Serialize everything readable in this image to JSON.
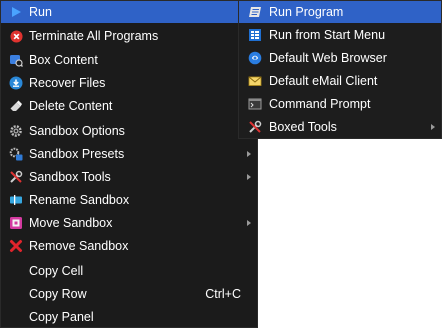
{
  "main_menu": {
    "items": [
      {
        "label": "Run",
        "icon": "play-icon",
        "submenu": true,
        "highlighted": true
      },
      {
        "label": "Terminate All Programs",
        "icon": "terminate-icon"
      },
      {
        "label": "Box Content",
        "icon": "box-content-icon"
      },
      {
        "label": "Recover Files",
        "icon": "recover-icon"
      },
      {
        "label": "Delete Content",
        "icon": "eraser-icon"
      },
      {
        "label": "Sandbox Options",
        "icon": "gear-icon"
      },
      {
        "label": "Sandbox Presets",
        "icon": "presets-icon",
        "submenu": true
      },
      {
        "label": "Sandbox Tools",
        "icon": "tools-icon",
        "submenu": true
      },
      {
        "label": "Rename Sandbox",
        "icon": "rename-icon"
      },
      {
        "label": "Move Sandbox",
        "icon": "move-icon",
        "submenu": true
      },
      {
        "label": "Remove Sandbox",
        "icon": "remove-icon"
      },
      {
        "label": "Copy Cell"
      },
      {
        "label": "Copy Row",
        "shortcut": "Ctrl+C"
      },
      {
        "label": "Copy Panel"
      }
    ]
  },
  "run_submenu": {
    "items": [
      {
        "label": "Run Program",
        "icon": "run-program-icon",
        "highlighted": true
      },
      {
        "label": "Run from Start Menu",
        "icon": "start-menu-icon"
      },
      {
        "label": "Default Web Browser",
        "icon": "browser-icon"
      },
      {
        "label": "Default eMail Client",
        "icon": "email-icon"
      },
      {
        "label": "Command Prompt",
        "icon": "command-prompt-icon"
      },
      {
        "label": "Boxed Tools",
        "icon": "tools-icon",
        "submenu": true
      }
    ]
  },
  "colors": {
    "menu_bg": "#1b1b1b",
    "highlight": "#2f62c7",
    "text": "#ffffff"
  }
}
